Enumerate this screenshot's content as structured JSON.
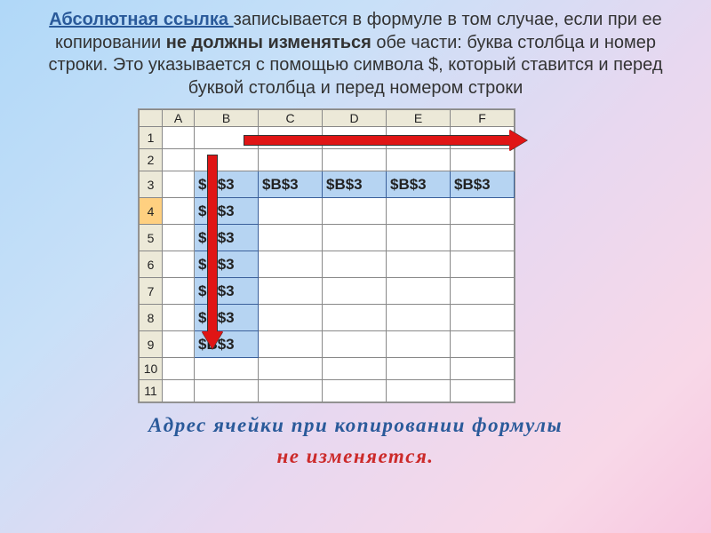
{
  "top": {
    "term": "Абсолютная ссылка ",
    "t1": "записывается в формуле в том случае, если при ее копировании ",
    "b1": "не должны изменяться",
    "t2": " обе части: буква столбца и номер строки. Это указывается с помощью символа $, который ставится и перед буквой столбца и перед номером строки"
  },
  "sheet": {
    "cols": [
      "A",
      "B",
      "C",
      "D",
      "E",
      "F"
    ],
    "rows": [
      "1",
      "2",
      "3",
      "4",
      "5",
      "6",
      "7",
      "8",
      "9",
      "10",
      "11"
    ],
    "ref": "$B$3"
  },
  "bottom": {
    "l1": "Адрес ячейки при копировании формулы",
    "l2": "не изменяется."
  }
}
